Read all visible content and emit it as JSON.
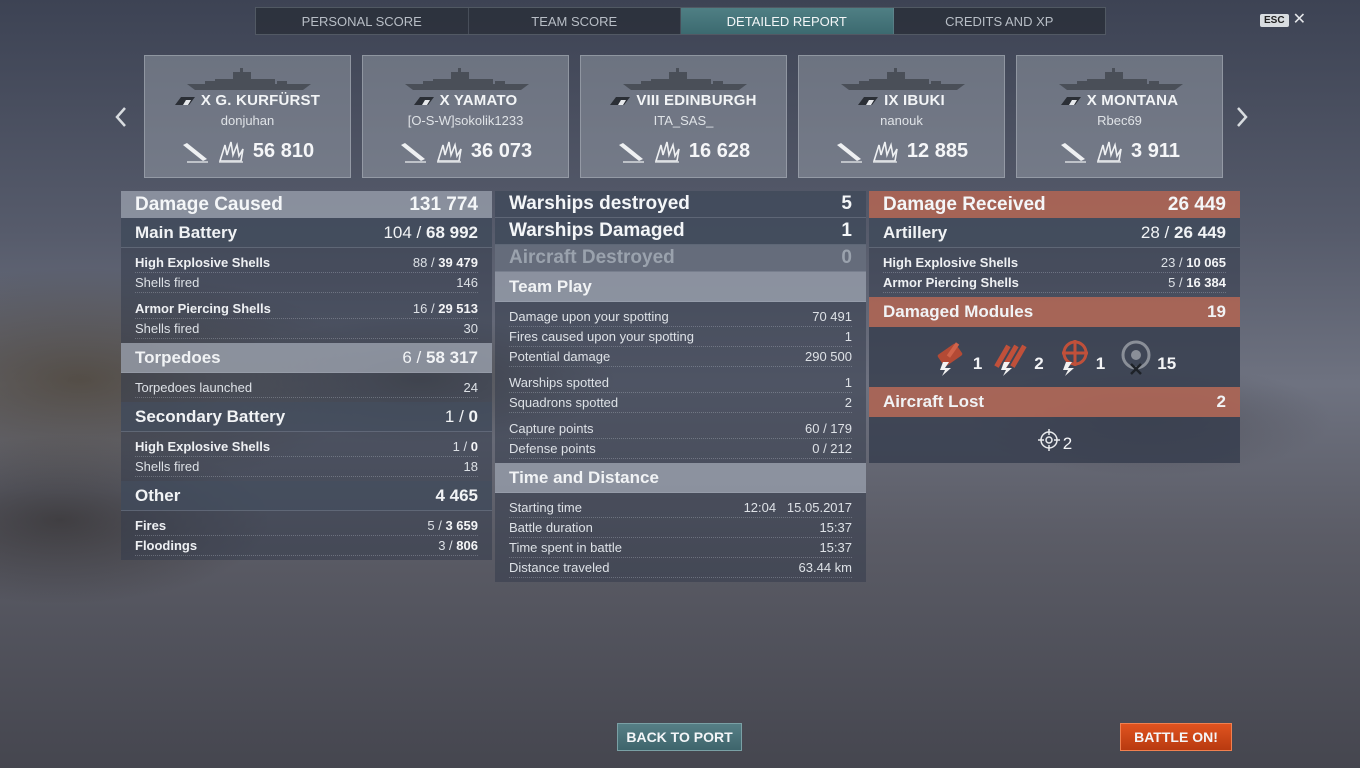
{
  "tabs": [
    "PERSONAL SCORE",
    "TEAM SCORE",
    "DETAILED REPORT",
    "CREDITS AND XP"
  ],
  "active_tab": "DETAILED REPORT",
  "esc_label": "ESC",
  "cards": [
    {
      "ship": "X G. KURFÜRST",
      "player": "donjuhan",
      "score": "56 810"
    },
    {
      "ship": "X YAMATO",
      "player": "[O-S-W]sokolik1233",
      "score": "36 073"
    },
    {
      "ship": "VIII EDINBURGH",
      "player": "ITA_SAS_",
      "score": "16 628"
    },
    {
      "ship": "IX IBUKI",
      "player": "nanouk",
      "score": "12 885"
    },
    {
      "ship": "X MONTANA",
      "player": "Rbec69",
      "score": "3 911"
    }
  ],
  "damage_caused": {
    "title": "Damage Caused",
    "total": "131 774",
    "main_battery": {
      "label": "Main Battery",
      "hits": "104 /",
      "damage": "68 992"
    },
    "he_label": "High Explosive Shells",
    "he_hits": "88 /",
    "he_damage": "39 479",
    "he_fired_label": "Shells fired",
    "he_fired": "146",
    "ap_label": "Armor Piercing Shells",
    "ap_hits": "16 /",
    "ap_damage": "29 513",
    "ap_fired_label": "Shells fired",
    "ap_fired": "30",
    "torpedoes": {
      "label": "Torpedoes",
      "hits": "6 /",
      "damage": "58 317"
    },
    "torp_launched_label": "Torpedoes launched",
    "torp_launched": "24",
    "secondary": {
      "label": "Secondary Battery",
      "hits": "1 /",
      "damage": "0"
    },
    "sec_he_label": "High Explosive Shells",
    "sec_he_hits": "1 /",
    "sec_he_damage": "0",
    "sec_fired_label": "Shells fired",
    "sec_fired": "18",
    "other": {
      "label": "Other",
      "value": "4 465"
    },
    "fires_label": "Fires",
    "fires_hits": "5 /",
    "fires_damage": "3 659",
    "flood_label": "Floodings",
    "flood_hits": "3 /",
    "flood_damage": "806"
  },
  "middle": {
    "destroyed_label": "Warships destroyed",
    "destroyed": "5",
    "damaged_label": "Warships Damaged",
    "damaged": "1",
    "aircraft_label": "Aircraft Destroyed",
    "aircraft": "0",
    "team_play": "Team Play",
    "team_rows": [
      {
        "label": "Damage upon your spotting",
        "value": "70 491"
      },
      {
        "label": "Fires caused upon your spotting",
        "value": "1"
      },
      {
        "label": "Potential damage",
        "value": "290 500"
      },
      {
        "label": "Warships spotted",
        "value": "1"
      },
      {
        "label": "Squadrons spotted",
        "value": "2"
      },
      {
        "label": "Capture points",
        "value": "60 / 179"
      },
      {
        "label": "Defense points",
        "value": "0 / 212"
      }
    ],
    "time_title": "Time and Distance",
    "time_rows": [
      {
        "label": "Starting time",
        "value": "12:04   15.05.2017"
      },
      {
        "label": "Battle duration",
        "value": "15:37"
      },
      {
        "label": "Time spent in battle",
        "value": "15:37"
      },
      {
        "label": "Distance traveled",
        "value": "63.44 km"
      }
    ]
  },
  "received": {
    "title": "Damage Received",
    "total": "26 449",
    "artillery": {
      "label": "Artillery",
      "hits": "28 /",
      "damage": "26 449"
    },
    "he_label": "High Explosive Shells",
    "he_hits": "23 /",
    "he_damage": "10 065",
    "ap_label": "Armor Piercing Shells",
    "ap_hits": "5 /",
    "ap_damage": "16 384",
    "modules_label": "Damaged Modules",
    "modules_total": "19",
    "modules": [
      {
        "icon": "gun-module-icon",
        "count": "1"
      },
      {
        "icon": "torpedo-module-icon",
        "count": "2"
      },
      {
        "icon": "steering-module-icon",
        "count": "1"
      },
      {
        "icon": "destroyed-module-icon",
        "count": "15"
      }
    ],
    "aircraft_label": "Aircraft Lost",
    "aircraft_total": "2",
    "aircraft_count": "2"
  },
  "buttons": {
    "back": "BACK TO PORT",
    "battle": "BATTLE ON!"
  },
  "colors": {
    "accent_teal": "#4f7f84",
    "received_red": "#b66856",
    "battle_orange": "#e0531f"
  }
}
